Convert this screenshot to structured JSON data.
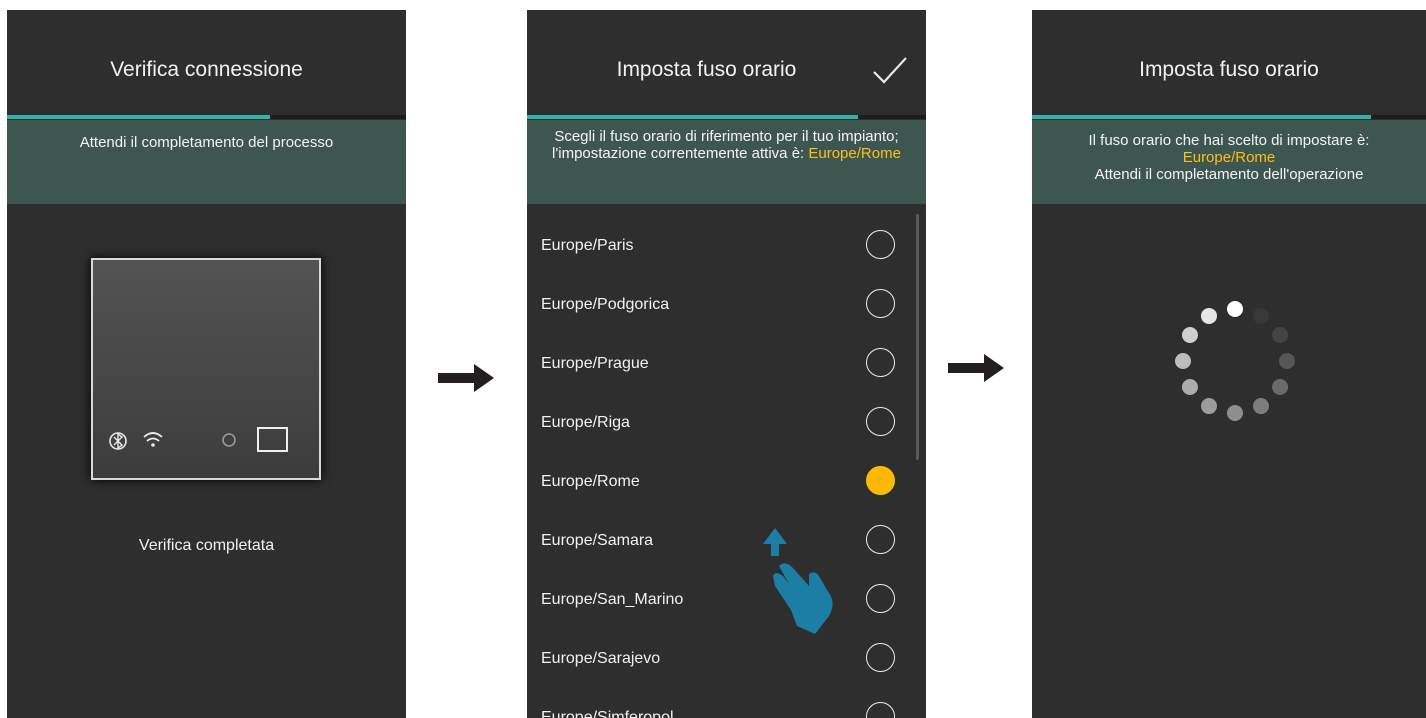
{
  "screen1": {
    "title": "Verifica connessione",
    "progress": 0.66,
    "banner": "Attendi il completamento del processo",
    "device_icons": [
      "bluetooth-icon",
      "wifi-icon",
      "led-icon",
      "square-icon"
    ],
    "status": "Verifica completata"
  },
  "screen2": {
    "title": "Imposta fuso orario",
    "confirm_icon": "checkmark-icon",
    "progress": 0.83,
    "banner_text": "Scegli il fuso orario di riferimento per il tuo impianto; l'impostazione correntemente attiva è: ",
    "banner_value": "Europe/Rome",
    "timezones": [
      {
        "label": "Europe/Paris",
        "selected": false
      },
      {
        "label": "Europe/Podgorica",
        "selected": false
      },
      {
        "label": "Europe/Prague",
        "selected": false
      },
      {
        "label": "Europe/Riga",
        "selected": false
      },
      {
        "label": "Europe/Rome",
        "selected": true
      },
      {
        "label": "Europe/Samara",
        "selected": false
      },
      {
        "label": "Europe/San_Marino",
        "selected": false
      },
      {
        "label": "Europe/Sarajevo",
        "selected": false
      },
      {
        "label": "Europe/Simferopol",
        "selected": false
      }
    ],
    "gesture_icon": "swipe-up-hand-icon"
  },
  "screen3": {
    "title": "Imposta fuso orario",
    "progress": 0.86,
    "banner_line1": "Il fuso orario che hai scelto di impostare è:",
    "banner_value": "Europe/Rome",
    "banner_line2": "Attendi il completamento dell'operazione",
    "spinner_icon": "loading-spinner-icon"
  },
  "arrows": [
    "right-arrow-icon",
    "right-arrow-icon"
  ],
  "colors": {
    "screen_bg": "#2e2e2e",
    "banner_bg": "#3e5650",
    "progress": "#2fb3a6",
    "accent": "#ffbf1a",
    "selected_radio": "#ffb900",
    "hand": "#1d7ea5"
  }
}
